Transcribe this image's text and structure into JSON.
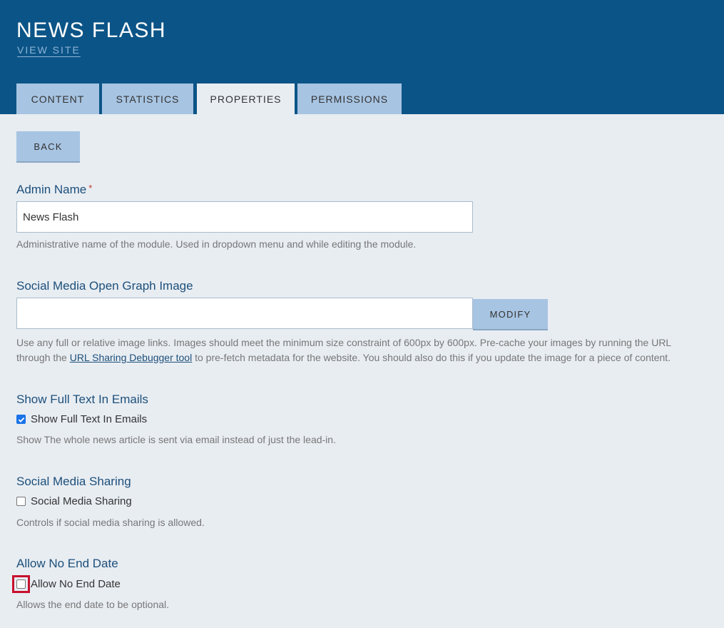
{
  "header": {
    "title": "NEWS FLASH",
    "view_site": "VIEW SITE"
  },
  "tabs": [
    {
      "label": "CONTENT",
      "active": false
    },
    {
      "label": "STATISTICS",
      "active": false
    },
    {
      "label": "PROPERTIES",
      "active": true
    },
    {
      "label": "PERMISSIONS",
      "active": false
    }
  ],
  "back_button": "BACK",
  "admin_name": {
    "label": "Admin Name",
    "required_mark": "*",
    "value": "News Flash",
    "help": "Administrative name of the module. Used in dropdown menu and while editing the module."
  },
  "og_image": {
    "label": "Social Media Open Graph Image",
    "value": "",
    "modify_button": "MODIFY",
    "help_line1": "Use any full or relative image links. Images should meet the minimum size constraint of 600px by 600px. Pre-cache your images by running the URL",
    "help_line2_before": "through the ",
    "help_link": "URL Sharing Debugger tool",
    "help_line2_after": " to pre-fetch metadata for the website. You should also do this if you update the image for a piece of content."
  },
  "full_text": {
    "label": "Show Full Text In Emails",
    "checkbox_label": "Show Full Text In Emails",
    "checked": true,
    "help": "Show The whole news article is sent via email instead of just the lead-in."
  },
  "social_sharing": {
    "label": "Social Media Sharing",
    "checkbox_label": "Social Media Sharing",
    "checked": false,
    "help": "Controls if social media sharing is allowed."
  },
  "no_end_date": {
    "label": "Allow No End Date",
    "checkbox_label": "Allow No End Date",
    "checked": false,
    "help": "Allows the end date to be optional."
  },
  "colors": {
    "header_bg": "#0b5487",
    "tab_bg": "#a7c4e2",
    "page_bg": "#e8edf2",
    "label": "#1d4f7a",
    "highlight": "#c8102e"
  }
}
